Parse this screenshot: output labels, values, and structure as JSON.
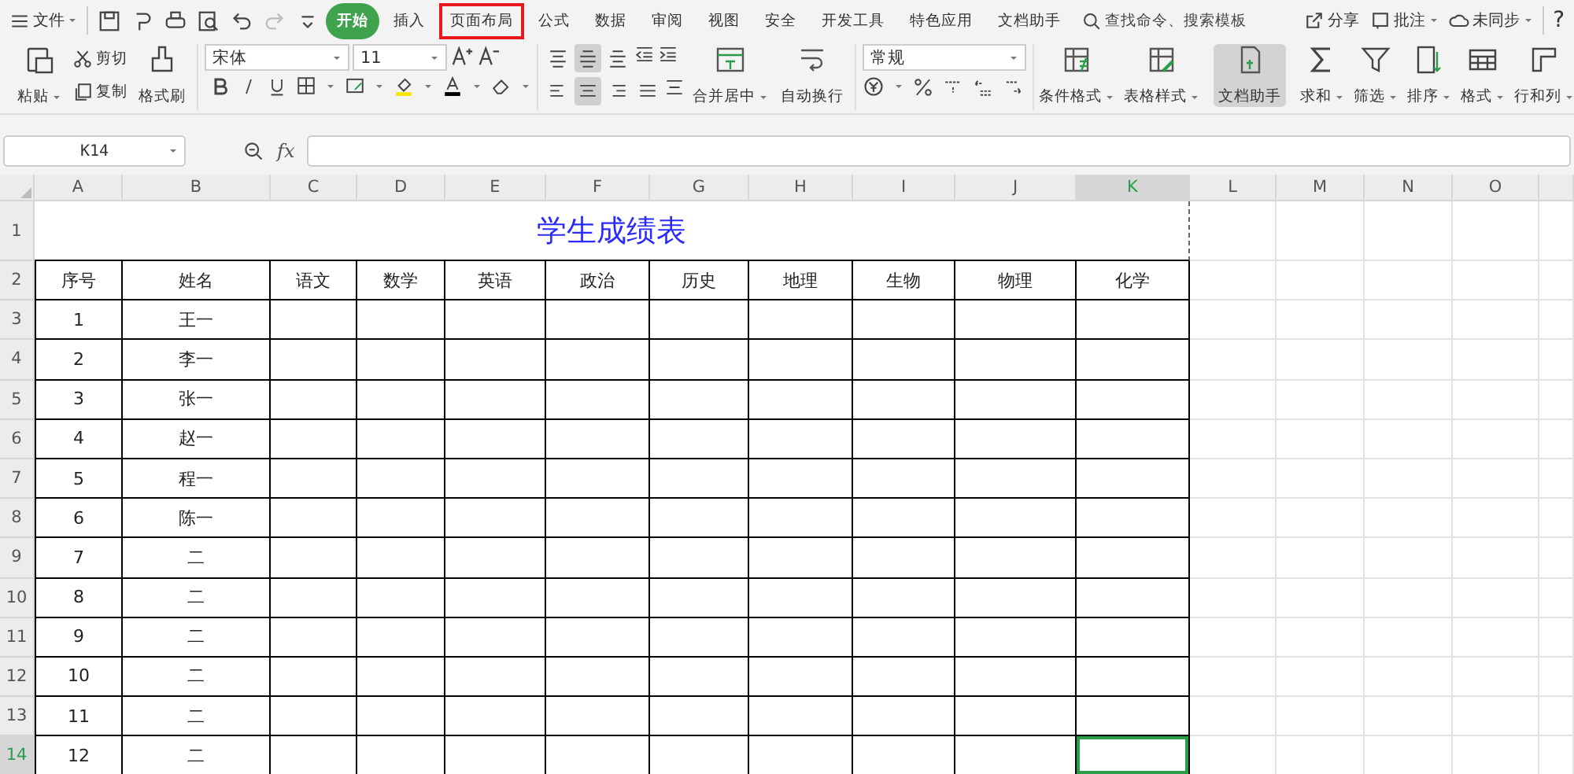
{
  "menu": {
    "file": "文件",
    "tabs": [
      {
        "label": "开始",
        "selected": true,
        "highlighted": false
      },
      {
        "label": "插入",
        "selected": false,
        "highlighted": false
      },
      {
        "label": "页面布局",
        "selected": false,
        "highlighted": true
      },
      {
        "label": "公式",
        "selected": false,
        "highlighted": false
      },
      {
        "label": "数据",
        "selected": false,
        "highlighted": false
      },
      {
        "label": "审阅",
        "selected": false,
        "highlighted": false
      },
      {
        "label": "视图",
        "selected": false,
        "highlighted": false
      },
      {
        "label": "安全",
        "selected": false,
        "highlighted": false
      },
      {
        "label": "开发工具",
        "selected": false,
        "highlighted": false
      },
      {
        "label": "特色应用",
        "selected": false,
        "highlighted": false
      },
      {
        "label": "文档助手",
        "selected": false,
        "highlighted": false
      }
    ],
    "search": "查找命令、搜索模板",
    "actions": [
      {
        "label": "分享",
        "dropdown": false
      },
      {
        "label": "批注",
        "dropdown": true
      },
      {
        "label": "未同步",
        "dropdown": true
      }
    ],
    "help": "?"
  },
  "ribbon": {
    "paste": "粘贴",
    "cut": "剪切",
    "copy": "复制",
    "painter": "格式刷",
    "font_name": "宋体",
    "font_size": "11",
    "valign": [
      {
        "selected": false
      },
      {
        "selected": true
      },
      {
        "selected": false
      }
    ],
    "halign": [
      {
        "selected": false
      },
      {
        "selected": true
      },
      {
        "selected": false
      },
      {
        "selected": false
      }
    ],
    "merge": "合并居中",
    "wrap": "自动换行",
    "number_format": "常规",
    "big_buttons": [
      {
        "label": "条件格式",
        "dropdown": true,
        "selected": false
      },
      {
        "label": "表格样式",
        "dropdown": true,
        "selected": false
      },
      {
        "label": "文档助手",
        "dropdown": false,
        "selected": true
      },
      {
        "label": "求和",
        "dropdown": true,
        "selected": false
      },
      {
        "label": "筛选",
        "dropdown": true,
        "selected": false
      },
      {
        "label": "排序",
        "dropdown": true,
        "selected": false
      },
      {
        "label": "格式",
        "dropdown": true,
        "selected": false
      },
      {
        "label": "行和列",
        "dropdown": true,
        "selected": false
      }
    ]
  },
  "formula_bar": {
    "cell": "K14",
    "fx": "fx"
  },
  "sheet": {
    "columns": [
      {
        "label": "A",
        "selected": false
      },
      {
        "label": "B",
        "selected": false
      },
      {
        "label": "C",
        "selected": false
      },
      {
        "label": "D",
        "selected": false
      },
      {
        "label": "E",
        "selected": false
      },
      {
        "label": "F",
        "selected": false
      },
      {
        "label": "G",
        "selected": false
      },
      {
        "label": "H",
        "selected": false
      },
      {
        "label": "I",
        "selected": false
      },
      {
        "label": "J",
        "selected": false
      },
      {
        "label": "K",
        "selected": true
      },
      {
        "label": "L",
        "selected": false
      },
      {
        "label": "M",
        "selected": false
      },
      {
        "label": "N",
        "selected": false
      },
      {
        "label": "O",
        "selected": false
      }
    ],
    "rows": [
      {
        "label": "1",
        "selected": false
      },
      {
        "label": "2",
        "selected": false
      },
      {
        "label": "3",
        "selected": false
      },
      {
        "label": "4",
        "selected": false
      },
      {
        "label": "5",
        "selected": false
      },
      {
        "label": "6",
        "selected": false
      },
      {
        "label": "7",
        "selected": false
      },
      {
        "label": "8",
        "selected": false
      },
      {
        "label": "9",
        "selected": false
      },
      {
        "label": "10",
        "selected": false
      },
      {
        "label": "11",
        "selected": false
      },
      {
        "label": "12",
        "selected": false
      },
      {
        "label": "13",
        "selected": false
      },
      {
        "label": "14",
        "selected": true
      }
    ],
    "title": "学生成绩表",
    "headers": [
      "序号",
      "姓名",
      "语文",
      "数学",
      "英语",
      "政治",
      "历史",
      "地理",
      "生物",
      "物理",
      "化学"
    ],
    "records": [
      {
        "seq": "1",
        "name": "王一"
      },
      {
        "seq": "2",
        "name": "李一"
      },
      {
        "seq": "3",
        "name": "张一"
      },
      {
        "seq": "4",
        "name": "赵一"
      },
      {
        "seq": "5",
        "name": "程一"
      },
      {
        "seq": "6",
        "name": "陈一"
      },
      {
        "seq": "7",
        "name": "二"
      },
      {
        "seq": "8",
        "name": "二"
      },
      {
        "seq": "9",
        "name": "二"
      },
      {
        "seq": "10",
        "name": "二"
      },
      {
        "seq": "11",
        "name": "二"
      },
      {
        "seq": "12",
        "name": "二"
      }
    ]
  }
}
